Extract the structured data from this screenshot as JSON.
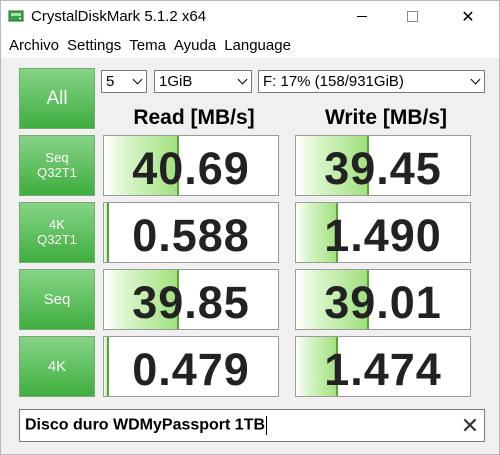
{
  "window": {
    "title": "CrystalDiskMark 5.1.2 x64"
  },
  "menu": [
    "Archivo",
    "Settings",
    "Tema",
    "Ayuda",
    "Language"
  ],
  "controls": {
    "all_label": "All",
    "count": "5",
    "size": "1GiB",
    "drive": "F: 17% (158/931GiB)"
  },
  "headers": {
    "read": "Read [MB/s]",
    "write": "Write [MB/s]"
  },
  "tests": [
    {
      "line1": "Seq",
      "line2": "Q32T1",
      "read": "40.69",
      "write": "39.45",
      "read_level": 0.43,
      "write_level": 0.42
    },
    {
      "line1": "4K",
      "line2": "Q32T1",
      "read": "0.588",
      "write": "1.490",
      "read_level": 0.03,
      "write_level": 0.24
    },
    {
      "line1": "Seq",
      "line2": "",
      "read": "39.85",
      "write": "39.01",
      "read_level": 0.43,
      "write_level": 0.42
    },
    {
      "line1": "4K",
      "line2": "",
      "read": "0.479",
      "write": "1.474",
      "read_level": 0.03,
      "write_level": 0.24
    }
  ],
  "comment": {
    "value": "Disco duro WDMyPassport 1TB"
  },
  "colors": {
    "button_green": "#3fae3f",
    "bar_green": "#9fe07c"
  }
}
